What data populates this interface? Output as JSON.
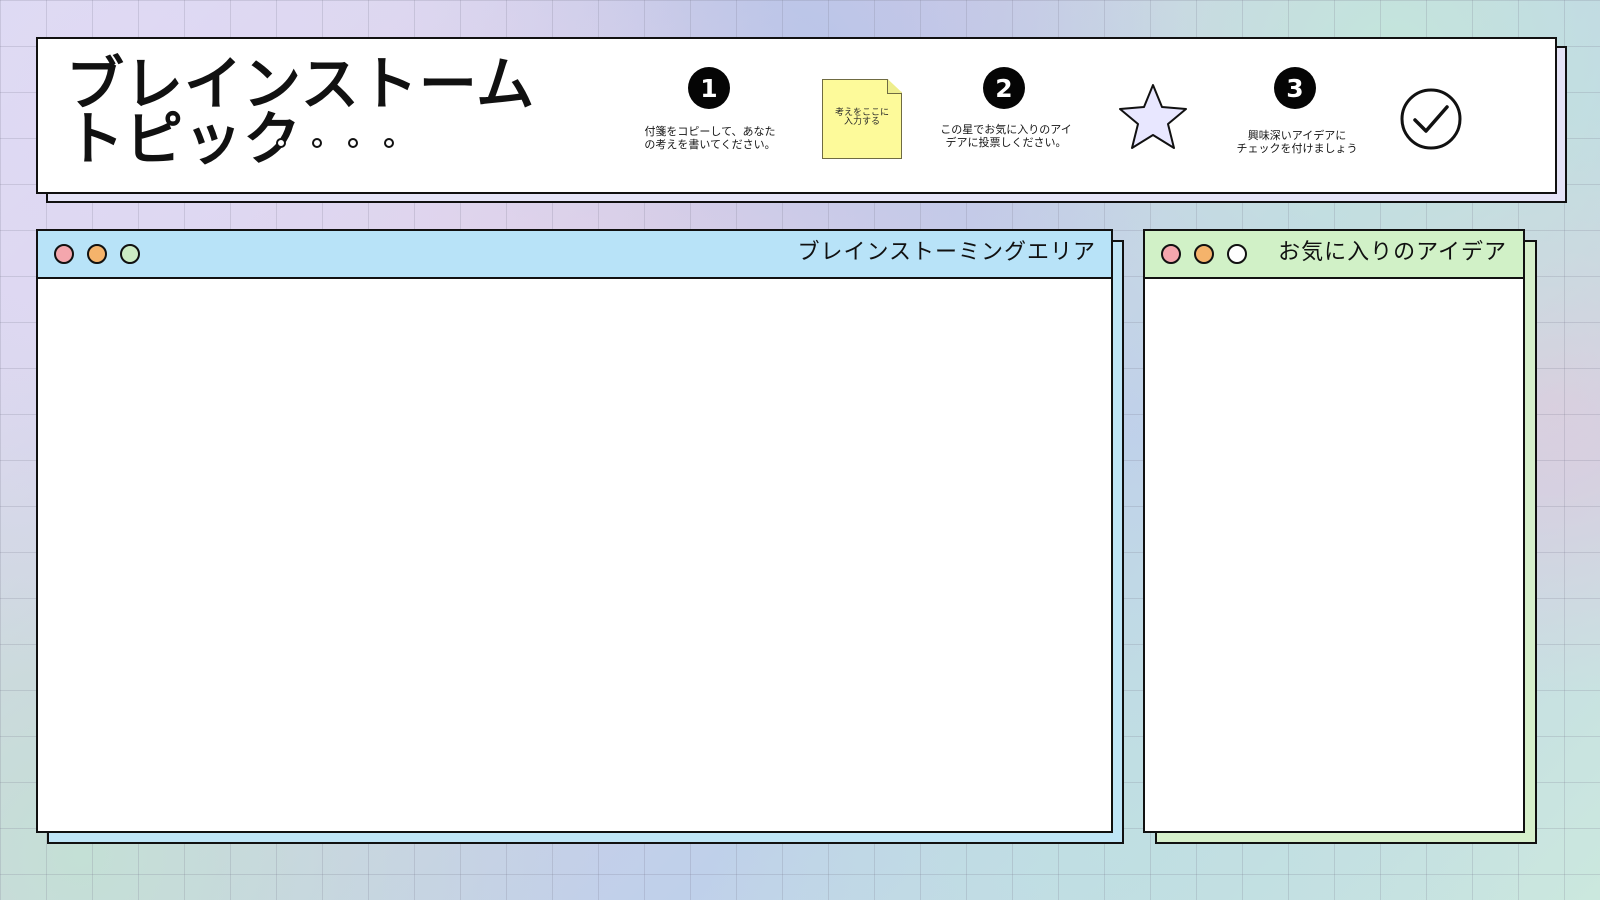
{
  "header": {
    "title": "ブレインストーム\nトピック",
    "steps": [
      {
        "number": "1",
        "text": "付箋をコピーして、あなた\nの考えを書いてください。"
      },
      {
        "number": "2",
        "text": "この星でお気に入りのアイ\nデアに投票しください。"
      },
      {
        "number": "3",
        "text": "興味深いアイデアに\nチェックを付けましょう"
      }
    ],
    "sticky_note": {
      "text": "考えをここに\n入力する"
    },
    "icons": {
      "star": "star-icon",
      "check": "check-circle-icon"
    }
  },
  "windows": {
    "brainstorm": {
      "title": "ブレインストーミングエリア"
    },
    "favorites": {
      "title": "お気に入りのアイデア"
    }
  },
  "colors": {
    "close_dot": "#f4a6ad",
    "minimize_dot": "#f5b36b",
    "maximize_dot": "#ccecc4",
    "brainstorm_header": "#b8e3f8",
    "favorites_header": "#d1f1c7",
    "sticky_note": "#fdfa9a",
    "star_fill": "#e8e7ff"
  }
}
